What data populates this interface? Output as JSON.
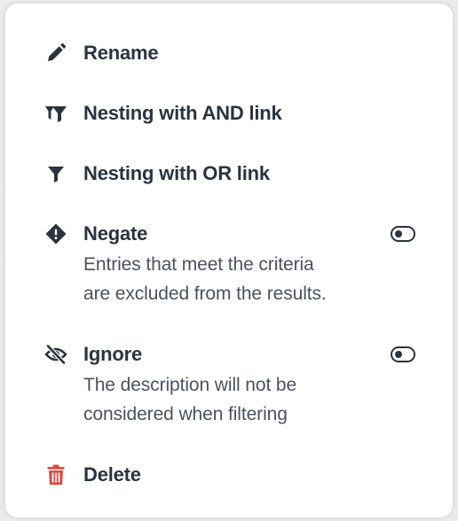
{
  "menu": {
    "rename": {
      "label": "Rename",
      "icon": "pencil-icon"
    },
    "nest_and": {
      "label": "Nesting with AND link",
      "icon": "filter-and-icon"
    },
    "nest_or": {
      "label": "Nesting with OR link",
      "icon": "filter-icon"
    },
    "negate": {
      "label": "Negate",
      "icon": "diamond-exclamation-icon",
      "description_line1": "Entries that meet the criteria",
      "description_line2": "are excluded from the results.",
      "toggle_on": false
    },
    "ignore": {
      "label": "Ignore",
      "icon": "eye-slash-icon",
      "description_line1": "The description will not be",
      "description_line2": "considered when filtering",
      "toggle_on": false
    },
    "delete": {
      "label": "Delete",
      "icon": "trash-icon"
    }
  },
  "colors": {
    "text": "#2a3340",
    "description": "#4a5260",
    "danger": "#e0463e",
    "background": "#ffffff"
  }
}
